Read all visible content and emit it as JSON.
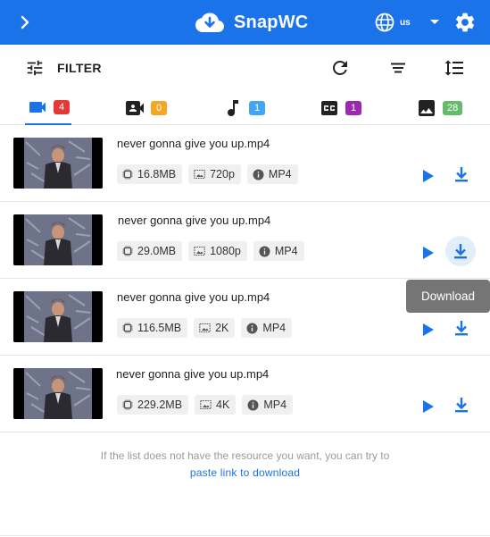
{
  "header": {
    "title": "SnapWC",
    "language": "us",
    "background": "#1a73e8",
    "icons": {
      "expand": "chevron-right-icon",
      "logo": "cloud-download-icon",
      "language": "globe-icon",
      "language_menu": "caret-down-icon",
      "settings": "gear-icon"
    }
  },
  "toolbar": {
    "filter_label": "FILTER",
    "icons": [
      "tune-icon",
      "refresh-icon",
      "sort-icon",
      "line-spacing-icon"
    ]
  },
  "tabs": [
    {
      "icon": "video-camera-icon",
      "count": "4",
      "badge_color": "#e53935",
      "active": true
    },
    {
      "icon": "contact-video-icon",
      "count": "0",
      "badge_color": "#f5a623",
      "active": false
    },
    {
      "icon": "music-note-icon",
      "count": "1",
      "badge_color": "#42a5f5",
      "active": false
    },
    {
      "icon": "closed-caption-icon",
      "count": "1",
      "badge_color": "#9c27b0",
      "active": false
    },
    {
      "icon": "image-icon",
      "count": "28",
      "badge_color": "#66bb6a",
      "active": false
    }
  ],
  "items": [
    {
      "name": "never gonna give you up.mp4",
      "size": "16.8MB",
      "quality": "720p",
      "format": "MP4"
    },
    {
      "name": "never gonna give you up.mp4",
      "size": "29.0MB",
      "quality": "1080p",
      "format": "MP4"
    },
    {
      "name": "never gonna give you up.mp4",
      "size": "116.5MB",
      "quality": "2K",
      "format": "MP4"
    },
    {
      "name": "never gonna give you up.mp4",
      "size": "229.2MB",
      "quality": "4K",
      "format": "MP4"
    }
  ],
  "tooltip": "Download",
  "footer": {
    "text": "If the list does not have the resource you want, you can try to",
    "link": "paste link to download"
  },
  "colors": {
    "accent": "#1a73e8",
    "chip_bg": "#f0f0f0",
    "tooltip_bg": "#757575"
  }
}
